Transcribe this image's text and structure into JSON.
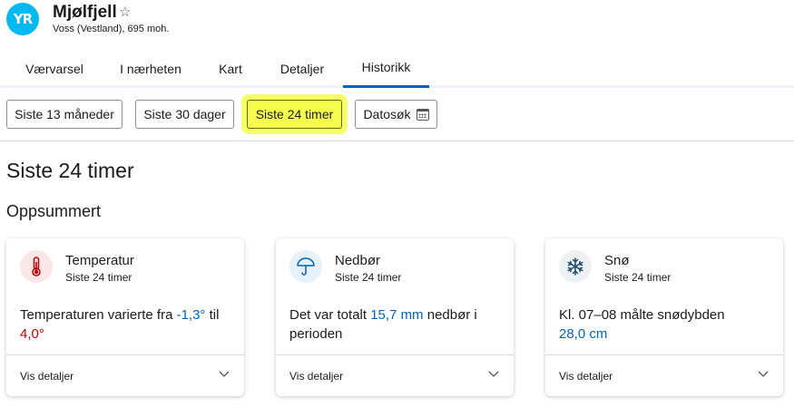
{
  "location": {
    "logo_text": "YR",
    "name": "Mjølfjell",
    "star_glyph": "☆",
    "subtitle": "Voss (Vestland), 695 moh."
  },
  "tabs": [
    {
      "label": "Værvarsel"
    },
    {
      "label": "I nærheten"
    },
    {
      "label": "Kart"
    },
    {
      "label": "Detaljer"
    },
    {
      "label": "Historikk",
      "active": true
    }
  ],
  "filters": {
    "btn_13": "Siste 13 måneder",
    "btn_30": "Siste 30 dager",
    "btn_24": "Siste 24 timer",
    "btn_date": "Datosøk",
    "active": "Siste 24 timer"
  },
  "headings": {
    "page": "Siste 24 timer",
    "section": "Oppsummert"
  },
  "cards": {
    "temp": {
      "icon": "thermometer-icon",
      "title": "Temperatur",
      "sub": "Siste 24 timer",
      "text_pre": "Temperaturen varierte fra ",
      "min_value": "-1,3°",
      "text_mid": " til",
      "max_value": "4,0°",
      "footer": "Vis detaljer"
    },
    "precip": {
      "icon": "umbrella-icon",
      "title": "Nedbør",
      "sub": "Siste 24 timer",
      "text_pre": "Det var totalt ",
      "value": "15,7 mm",
      "text_post": " nedbør i perioden",
      "footer": "Vis detaljer"
    },
    "snow": {
      "icon": "snowflake-icon",
      "title": "Snø",
      "sub": "Siste 24 timer",
      "text_pre": "Kl. 07–08 målte snødybden",
      "value": "28,0 cm",
      "footer": "Vis detaljer"
    }
  },
  "colors": {
    "accent_blue": "#0062ba",
    "logo_blue": "#00b9f1",
    "warm_red": "#c60000",
    "highlight": "#f6ff4d"
  }
}
